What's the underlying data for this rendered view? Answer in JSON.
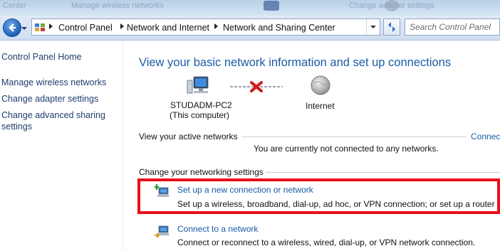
{
  "window": {
    "background_hint_texts": [
      "Center",
      "Manage wireless networks",
      "Change adapter settings"
    ]
  },
  "address_bar": {
    "breadcrumbs": [
      "Control Panel",
      "Network and Internet",
      "Network and Sharing Center"
    ],
    "search_placeholder": "Search Control Panel"
  },
  "sidebar": {
    "items": [
      {
        "label": "Control Panel Home"
      },
      {
        "label": "Manage wireless networks"
      },
      {
        "label": "Change adapter settings"
      },
      {
        "label": "Change advanced sharing settings"
      }
    ]
  },
  "main": {
    "title": "View your basic network information and set up connections",
    "map": {
      "computer_name": "STUDADM-PC2",
      "computer_sub": "(This computer)",
      "internet_label": "Internet",
      "connection_status_icon": "red-x-disconnected"
    },
    "active_networks": {
      "heading": "View your active networks",
      "link": "Connec",
      "status": "You are currently not connected to any networks."
    },
    "settings": {
      "heading": "Change your networking settings",
      "items": [
        {
          "title": "Set up a new connection or network",
          "description": "Set up a wireless, broadband, dial-up, ad hoc, or VPN connection; or set up a router o",
          "icon": "new-connection-icon"
        },
        {
          "title": "Connect to a network",
          "description": "Connect or reconnect to a wireless, wired, dial-up, or VPN network connection.",
          "icon": "connect-network-icon"
        }
      ]
    }
  },
  "colors": {
    "link": "#1a5aa6",
    "title": "#1b5ba6",
    "highlight": "#e8101a"
  }
}
